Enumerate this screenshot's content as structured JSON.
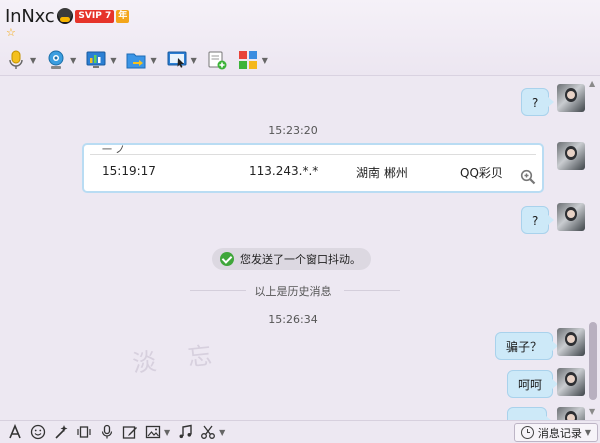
{
  "header": {
    "contact_name": "InNxc",
    "vip_label": "SVIP 7",
    "year_label": "年"
  },
  "chat": {
    "messages": [
      {
        "text": "?"
      },
      {
        "timestamp": "15:23:20"
      },
      {
        "card": {
          "time": "15:19:17",
          "ip": "113.243.*.*",
          "location": "湖南 郴州",
          "app": "QQ彩贝"
        }
      },
      {
        "text": "?"
      },
      {
        "system": "您发送了一个窗口抖动。"
      },
      {
        "divider": "以上是历史消息"
      },
      {
        "timestamp": "15:26:34"
      },
      {
        "text": "骗子？"
      },
      {
        "text": "呵呵"
      }
    ]
  },
  "watermark": "淡 忘",
  "footer": {
    "history_button_label": "消息记录"
  },
  "colors": {
    "bubble": "#cde9f8",
    "bubble_border": "#a9d2ec",
    "background": "#ede8f2",
    "card_border": "#b9dcf3"
  }
}
